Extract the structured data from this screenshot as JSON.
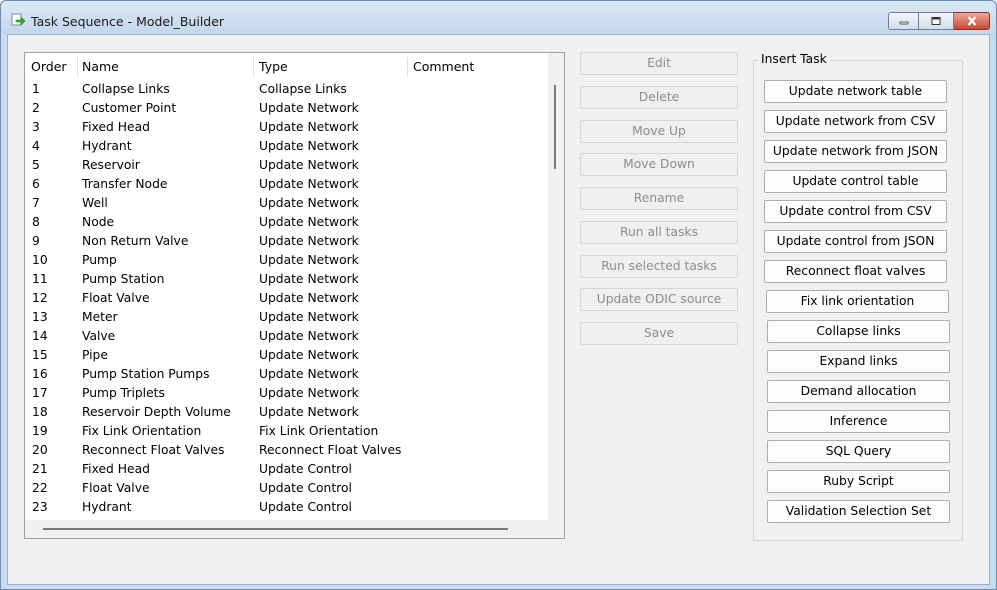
{
  "window": {
    "title": "Task Sequence - Model_Builder"
  },
  "list": {
    "columns": [
      "Order",
      "Name",
      "Type",
      "Comment"
    ],
    "rows": [
      [
        "1",
        "Collapse Links",
        "Collapse Links",
        ""
      ],
      [
        "2",
        "Customer Point",
        "Update Network",
        ""
      ],
      [
        "3",
        "Fixed Head",
        "Update Network",
        ""
      ],
      [
        "4",
        "Hydrant",
        "Update Network",
        ""
      ],
      [
        "5",
        "Reservoir",
        "Update Network",
        ""
      ],
      [
        "6",
        "Transfer Node",
        "Update Network",
        ""
      ],
      [
        "7",
        "Well",
        "Update Network",
        ""
      ],
      [
        "8",
        "Node",
        "Update Network",
        ""
      ],
      [
        "9",
        "Non Return Valve",
        "Update Network",
        ""
      ],
      [
        "10",
        "Pump",
        "Update Network",
        ""
      ],
      [
        "11",
        "Pump Station",
        "Update Network",
        ""
      ],
      [
        "12",
        "Float Valve",
        "Update Network",
        ""
      ],
      [
        "13",
        "Meter",
        "Update Network",
        ""
      ],
      [
        "14",
        "Valve",
        "Update Network",
        ""
      ],
      [
        "15",
        "Pipe",
        "Update Network",
        ""
      ],
      [
        "16",
        "Pump Station Pumps",
        "Update Network",
        ""
      ],
      [
        "17",
        "Pump Triplets",
        "Update Network",
        ""
      ],
      [
        "18",
        "Reservoir Depth Volume",
        "Update Network",
        ""
      ],
      [
        "19",
        "Fix Link Orientation",
        "Fix Link Orientation",
        ""
      ],
      [
        "20",
        "Reconnect Float Valves",
        "Reconnect Float Valves",
        ""
      ],
      [
        "21",
        "Fixed Head",
        "Update Control",
        ""
      ],
      [
        "22",
        "Float Valve",
        "Update Control",
        ""
      ],
      [
        "23",
        "Hydrant",
        "Update Control",
        ""
      ]
    ]
  },
  "actions": {
    "edit": "Edit",
    "delete": "Delete",
    "move_up": "Move Up",
    "move_down": "Move Down",
    "rename": "Rename",
    "run_all": "Run all tasks",
    "run_selected": "Run selected tasks",
    "update_odic": "Update ODIC source",
    "save": "Save"
  },
  "insert_task": {
    "label": "Insert Task",
    "buttons": [
      "Update network table",
      "Update network from CSV",
      "Update network from JSON",
      "Update control table",
      "Update control from CSV",
      "Update control from JSON",
      "Reconnect float valves",
      "Fix link orientation",
      "Collapse links",
      "Expand links",
      "Demand allocation",
      "Inference",
      "SQL Query",
      "Ruby Script",
      "Validation Selection Set"
    ]
  },
  "icons": {
    "app": "task-sequence-icon",
    "minimize": "minimize-icon",
    "maximize": "maximize-icon",
    "close": "close-icon"
  },
  "colors": {
    "close_button": "#c74a35",
    "disabled_text": "#8d8d8d",
    "title_bar": "#c9dbef"
  }
}
